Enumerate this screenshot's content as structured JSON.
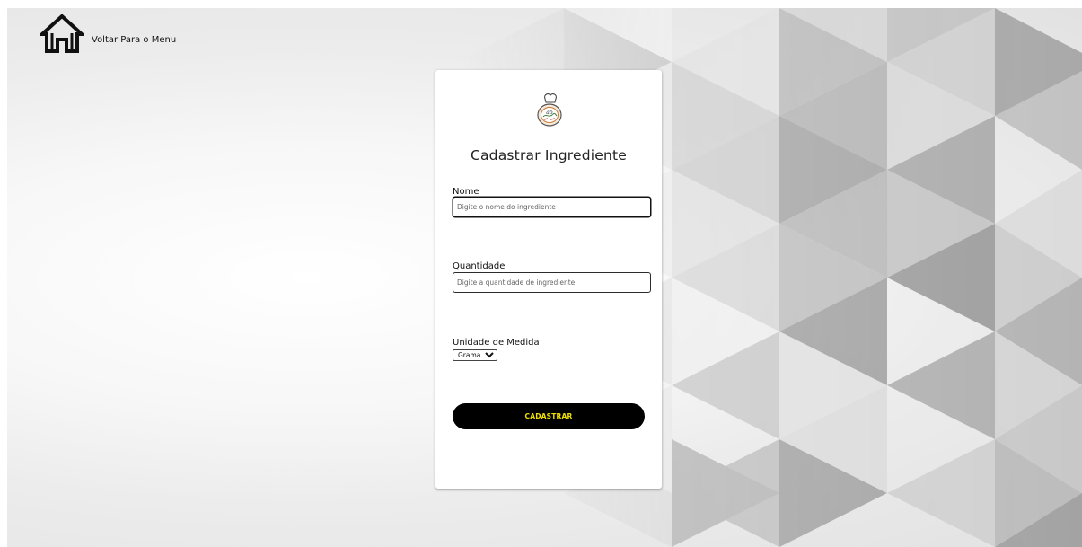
{
  "nav": {
    "back_label": "Voltar Para o Menu",
    "home_icon": "home-icon"
  },
  "form": {
    "logo_icon": "chef-hat-logo-icon",
    "title": "Cadastrar Ingrediente",
    "nome": {
      "label": "Nome",
      "value": "",
      "placeholder": "Digite o nome do ingrediente"
    },
    "quantidade": {
      "label": "Quantidade",
      "value": "",
      "placeholder": "Digite a quantidade de ingrediente"
    },
    "unidade": {
      "label": "Unidade de Medida",
      "selected": "Grama"
    },
    "submit_label": "CADASTRAR"
  },
  "colors": {
    "button_bg": "#000000",
    "button_text": "#f0e000",
    "card_bg": "#ffffff",
    "background": "#ececec"
  }
}
